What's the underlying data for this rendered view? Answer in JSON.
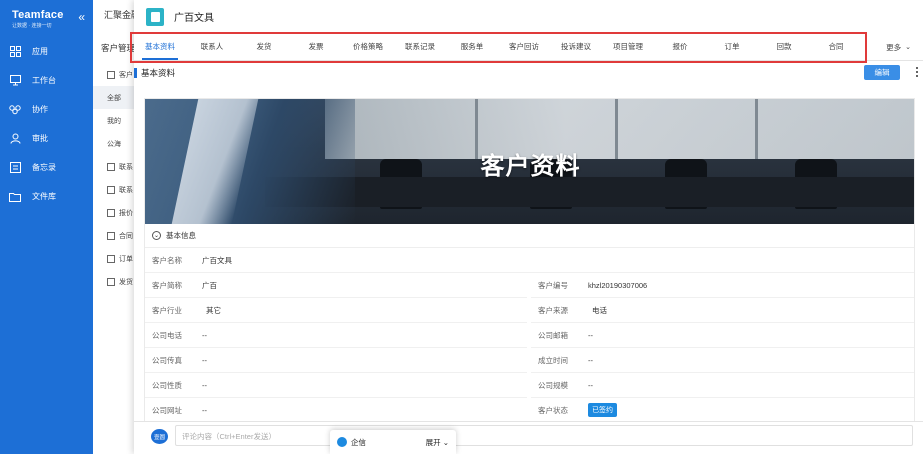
{
  "sidebar": {
    "brand": "Teamface",
    "tagline": "让数据 · 连接一切",
    "collapse_glyph": "«",
    "items": [
      {
        "label": "应用",
        "icon": "apps-icon"
      },
      {
        "label": "工作台",
        "icon": "monitor-icon"
      },
      {
        "label": "协作",
        "icon": "collaboration-icon"
      },
      {
        "label": "审批",
        "icon": "user-icon"
      },
      {
        "label": "备忘录",
        "icon": "memo-icon"
      },
      {
        "label": "文件库",
        "icon": "folder-icon"
      }
    ]
  },
  "background": {
    "title": "汇聚金融",
    "subtitle": "客户管理",
    "menu": [
      {
        "label": "客户"
      },
      {
        "label": "全部"
      },
      {
        "label": "我的"
      },
      {
        "label": "公海"
      },
      {
        "label": "联系"
      },
      {
        "label": "联系"
      },
      {
        "label": "报价"
      },
      {
        "label": "合同"
      },
      {
        "label": "订单"
      },
      {
        "label": "发货"
      }
    ]
  },
  "record": {
    "title": "广百文具",
    "tabs": [
      "基本资料",
      "联系人",
      "发货",
      "发票",
      "价格策略",
      "联系记录",
      "服务单",
      "客户回访",
      "投诉建议",
      "项目管理",
      "报价",
      "订单",
      "回款",
      "合同"
    ],
    "more_label": "更多",
    "section_label": "基本资料",
    "edit_label": "编辑",
    "banner_title": "客户资料",
    "info_section": "基本信息",
    "fields_left": [
      {
        "label": "客户名称",
        "value": "广百文具"
      },
      {
        "label": "客户简称",
        "value": "广百"
      },
      {
        "label": "客户行业",
        "value": "其它"
      },
      {
        "label": "公司电话",
        "value": "--"
      },
      {
        "label": "公司传真",
        "value": "--"
      },
      {
        "label": "公司性质",
        "value": "--"
      },
      {
        "label": "公司网址",
        "value": "--"
      }
    ],
    "fields_right": [
      {
        "label": "客户编号",
        "value": "khzl20190307006"
      },
      {
        "label": "客户来源",
        "value": "电话"
      },
      {
        "label": "公司邮箱",
        "value": "--"
      },
      {
        "label": "成立时间",
        "value": "--"
      },
      {
        "label": "公司规模",
        "value": "--"
      },
      {
        "label": "客户状态",
        "value": "已签约"
      }
    ]
  },
  "comment": {
    "avatar_text": "壹圆",
    "placeholder": "评论内容（Ctrl+Enter发送）"
  },
  "im": {
    "label": "企信",
    "expand_label": "展开"
  }
}
